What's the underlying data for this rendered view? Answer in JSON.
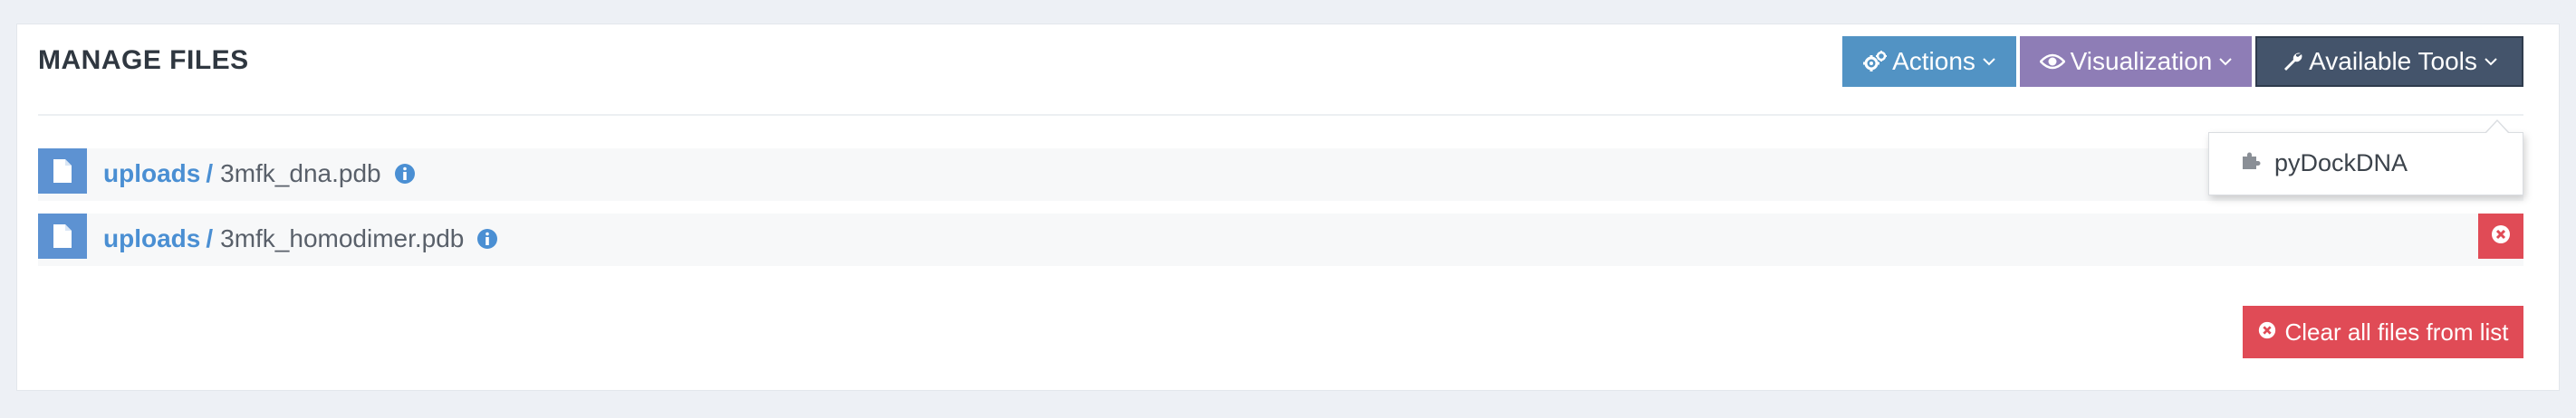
{
  "panel": {
    "title": "MANAGE FILES"
  },
  "toolbar": {
    "actions_label": "Actions",
    "visualization_label": "Visualization",
    "tools_label": "Available Tools"
  },
  "files": [
    {
      "folder": "uploads",
      "separator": "/",
      "name": "3mfk_dna.pdb"
    },
    {
      "folder": "uploads",
      "separator": "/",
      "name": "3mfk_homodimer.pdb"
    }
  ],
  "clear_button_label": "Clear all files from list",
  "tools_dropdown": {
    "items": [
      {
        "label": "pyDockDNA",
        "icon": "puzzle-icon"
      }
    ]
  },
  "colors": {
    "actions": "#5293c4",
    "visualization": "#8e7db6",
    "tools": "#44546b",
    "danger": "#e04b56",
    "file_icon": "#5d92d2",
    "link": "#4a8fd3"
  }
}
